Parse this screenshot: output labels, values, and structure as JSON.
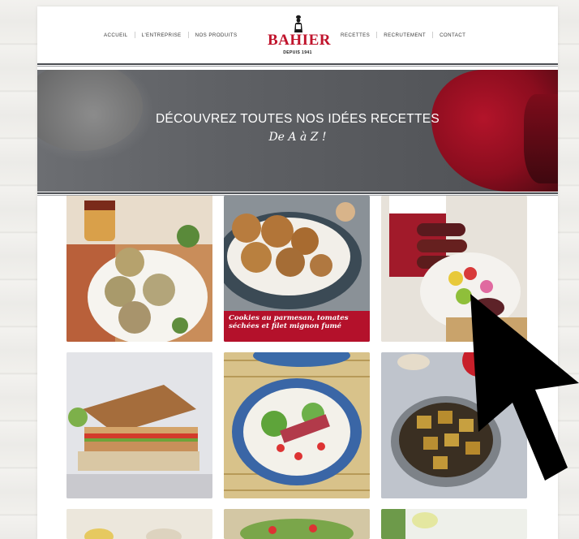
{
  "nav": {
    "left": [
      "ACCUEIL",
      "L'ENTREPRISE",
      "NOS PRODUITS"
    ],
    "right": [
      "RECETTES",
      "RECRUTEMENT",
      "CONTACT"
    ]
  },
  "logo": {
    "name": "BAHIER",
    "tagline": "DEPUIS 1941"
  },
  "banner": {
    "title": "DÉCOUVREZ TOUTES NOS IDÉES RECETTES",
    "subtitle": "De A à Z !"
  },
  "recipes": {
    "r2_caption": "Cookies au parmesan, tomates séchées et filet mignon fumé"
  },
  "colors": {
    "brand_red": "#c0142c",
    "caption_red": "#b4112b",
    "rule": "#4a4d52"
  }
}
